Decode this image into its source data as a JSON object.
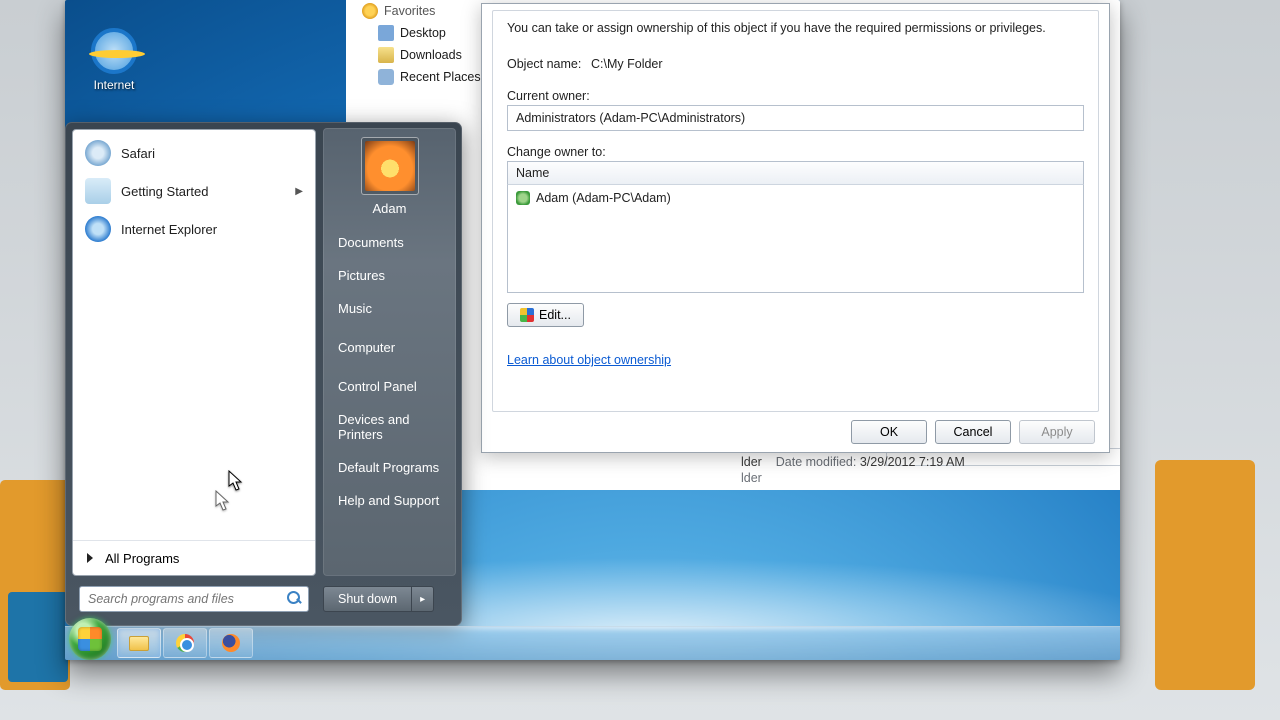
{
  "desktop_icon": {
    "label": "Internet"
  },
  "explorer": {
    "favorites_label": "Favorites",
    "nav": [
      {
        "icon": "desktop",
        "label": "Desktop"
      },
      {
        "icon": "downloads",
        "label": "Downloads"
      },
      {
        "icon": "recent",
        "label": "Recent Places"
      }
    ],
    "details": {
      "date_modified_label": "Date modified:",
      "date_modified_value": "3/29/2012 7:19 AM",
      "type_suffix": "lder",
      "name_suffix": "lder"
    }
  },
  "dialog": {
    "intro": "You can take or assign ownership of this object if you have the required permissions or privileges.",
    "object_name_label": "Object name:",
    "object_name_value": "C:\\My Folder",
    "current_owner_label": "Current owner:",
    "current_owner_value": "Administrators (Adam-PC\\Administrators)",
    "change_owner_label": "Change owner to:",
    "list_header": "Name",
    "owners": [
      {
        "name": "Adam (Adam-PC\\Adam)"
      }
    ],
    "edit_label": "Edit...",
    "learn_link": "Learn about object ownership",
    "ok": "OK",
    "cancel": "Cancel",
    "apply": "Apply"
  },
  "start_menu": {
    "programs": [
      {
        "id": "safari",
        "label": "Safari",
        "submenu": false
      },
      {
        "id": "getting-started",
        "label": "Getting Started",
        "submenu": true
      },
      {
        "id": "ie",
        "label": "Internet Explorer",
        "submenu": false
      }
    ],
    "all_programs": "All Programs",
    "search_placeholder": "Search programs and files",
    "user": "Adam",
    "links": [
      "Documents",
      "Pictures",
      "Music",
      "Computer",
      "Control Panel",
      "Devices and Printers",
      "Default Programs",
      "Help and Support"
    ],
    "shutdown": "Shut down"
  },
  "taskbar": {
    "pins": [
      {
        "id": "explorer",
        "active": true
      },
      {
        "id": "chrome",
        "active": false
      },
      {
        "id": "firefox",
        "active": false
      }
    ]
  }
}
